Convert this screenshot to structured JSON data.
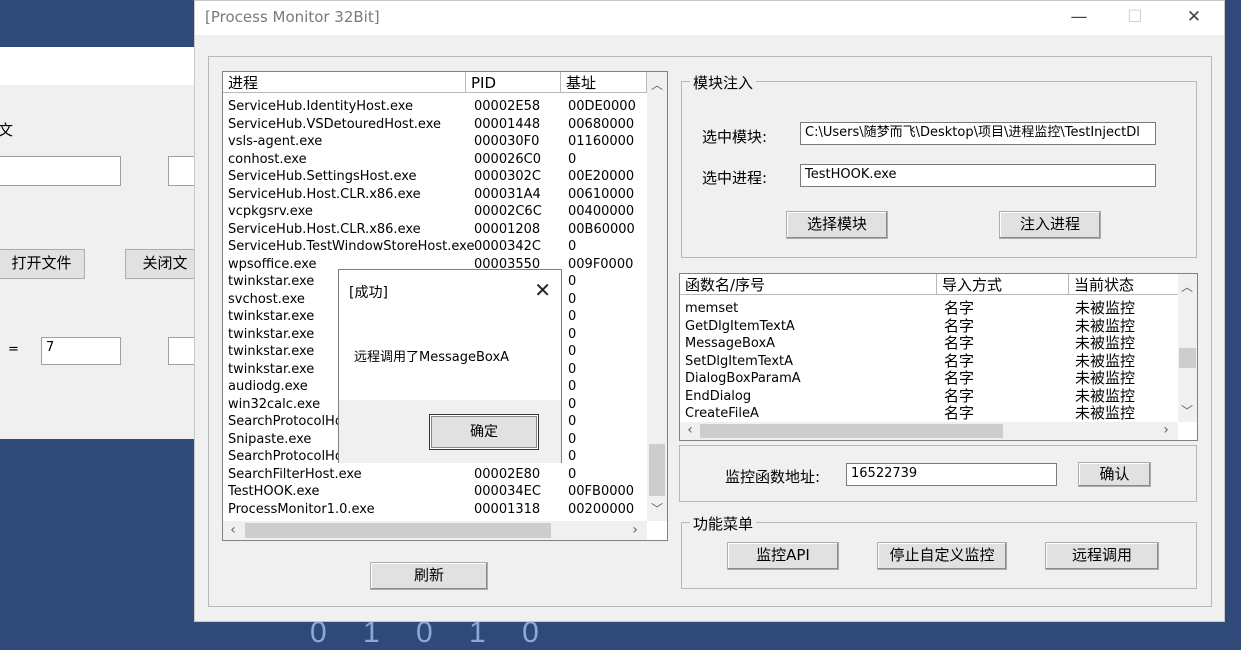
{
  "background": {
    "digits": "0 1 0 1 0",
    "window": {
      "label_top": "文",
      "open_file": "打开文件",
      "close_file": "关闭文",
      "equals": "=",
      "number_value": "7"
    }
  },
  "window": {
    "title": "[Process Monitor 32Bit]",
    "minimize": "—",
    "maximize": "☐",
    "close": "✕"
  },
  "process_list": {
    "headers": [
      "进程",
      "PID",
      "基址"
    ],
    "rows": [
      [
        "ServiceHub.IdentityHost.exe",
        "00002E58",
        "00DE0000"
      ],
      [
        "ServiceHub.VSDetouredHost.exe",
        "00001448",
        "00680000"
      ],
      [
        "vsls-agent.exe",
        "000030F0",
        "01160000"
      ],
      [
        "conhost.exe",
        "000026C0",
        "0"
      ],
      [
        "ServiceHub.SettingsHost.exe",
        "0000302C",
        "00E20000"
      ],
      [
        "ServiceHub.Host.CLR.x86.exe",
        "000031A4",
        "00610000"
      ],
      [
        "vcpkgsrv.exe",
        "00002C6C",
        "00400000"
      ],
      [
        "ServiceHub.Host.CLR.x86.exe",
        "00001208",
        "00B60000"
      ],
      [
        "ServiceHub.TestWindowStoreHost.exe",
        "0000342C",
        "0"
      ],
      [
        "wpsoffice.exe",
        "00003550",
        "009F0000"
      ],
      [
        "twinkstar.exe",
        "",
        "0"
      ],
      [
        "svchost.exe",
        "",
        "0"
      ],
      [
        "twinkstar.exe",
        "",
        "0"
      ],
      [
        "twinkstar.exe",
        "",
        "0"
      ],
      [
        "twinkstar.exe",
        "",
        "0"
      ],
      [
        "twinkstar.exe",
        "",
        "0"
      ],
      [
        "audiodg.exe",
        "",
        "0"
      ],
      [
        "win32calc.exe",
        "",
        "0"
      ],
      [
        "SearchProtocolHos",
        "",
        "0"
      ],
      [
        "Snipaste.exe",
        "",
        "0"
      ],
      [
        "SearchProtocolHos",
        "",
        "0"
      ],
      [
        "SearchFilterHost.exe",
        "00002E80",
        "0"
      ],
      [
        "TestHOOK.exe",
        "000034EC",
        "00FB0000"
      ],
      [
        "ProcessMonitor1.0.exe",
        "00001318",
        "00200000"
      ]
    ],
    "refresh_button": "刷新"
  },
  "inject": {
    "group_title": "模块注入",
    "module_label": "选中模块:",
    "module_value": "C:\\Users\\随梦而飞\\Desktop\\项目\\进程监控\\TestInjectDl",
    "process_label": "选中进程:",
    "process_value": "TestHOOK.exe",
    "select_module_button": "选择模块",
    "inject_button": "注入进程"
  },
  "func_list": {
    "headers": [
      "函数名/序号",
      "导入方式",
      "当前状态"
    ],
    "rows": [
      [
        "memset",
        "名字",
        "未被监控"
      ],
      [
        "GetDlgItemTextA",
        "名字",
        "未被监控"
      ],
      [
        "MessageBoxA",
        "名字",
        "未被监控"
      ],
      [
        "SetDlgItemTextA",
        "名字",
        "未被监控"
      ],
      [
        "DialogBoxParamA",
        "名字",
        "未被监控"
      ],
      [
        "EndDialog",
        "名字",
        "未被监控"
      ],
      [
        "CreateFileA",
        "名字",
        "未被监控"
      ]
    ],
    "addr_label": "监控函数地址:",
    "addr_value": "16522739",
    "confirm_button": "确认"
  },
  "menu": {
    "group_title": "功能菜单",
    "monitor_api": "监控API",
    "stop_custom": "停止自定义监控",
    "remote_call": "远程调用"
  },
  "msgbox": {
    "title": "[成功]",
    "close": "✕",
    "text": "远程调用了MessageBoxA",
    "ok": "确定"
  }
}
